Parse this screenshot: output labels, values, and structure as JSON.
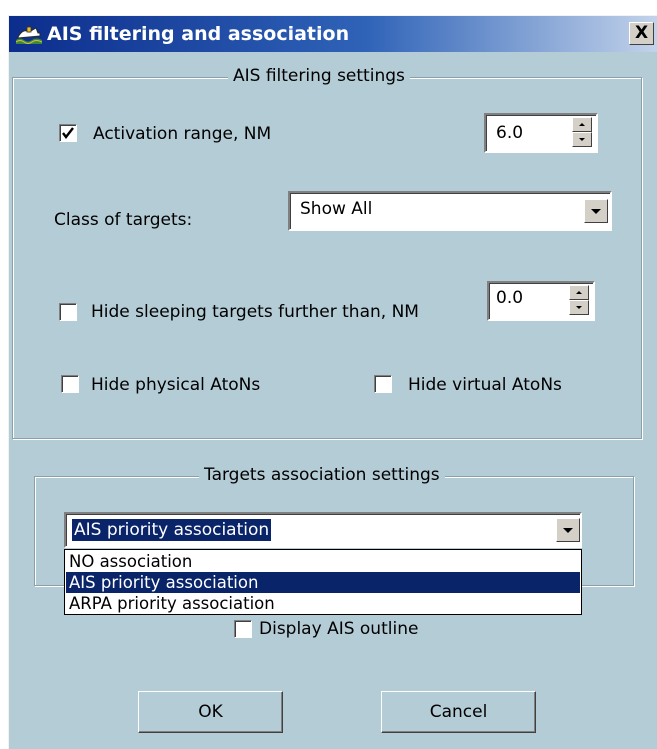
{
  "window": {
    "title": "AIS filtering and association",
    "close_label": "X"
  },
  "filtering": {
    "legend": "AIS filtering settings",
    "activation": {
      "label": "Activation  range, NM",
      "checked": true,
      "value": "6.0"
    },
    "class_of_targets": {
      "label": "Class of targets:",
      "value": "Show All"
    },
    "hide_sleeping": {
      "label": "Hide sleeping targets further than, NM",
      "checked": false,
      "value": "0.0"
    },
    "hide_physical": {
      "label": "Hide physical AtoNs",
      "checked": false
    },
    "hide_virtual": {
      "label": "Hide virtual AtoNs",
      "checked": false
    }
  },
  "association": {
    "legend": "Targets association settings",
    "selected": "AIS priority association",
    "options": [
      "NO association",
      "AIS priority association",
      "ARPA priority association"
    ],
    "display_outline_label": "Display AIS outline"
  },
  "buttons": {
    "ok": "OK",
    "cancel": "Cancel"
  },
  "colors": {
    "dialog_bg": "#b4ccd6",
    "selection": "#0a246a",
    "title_start": "#0c2d8c"
  }
}
